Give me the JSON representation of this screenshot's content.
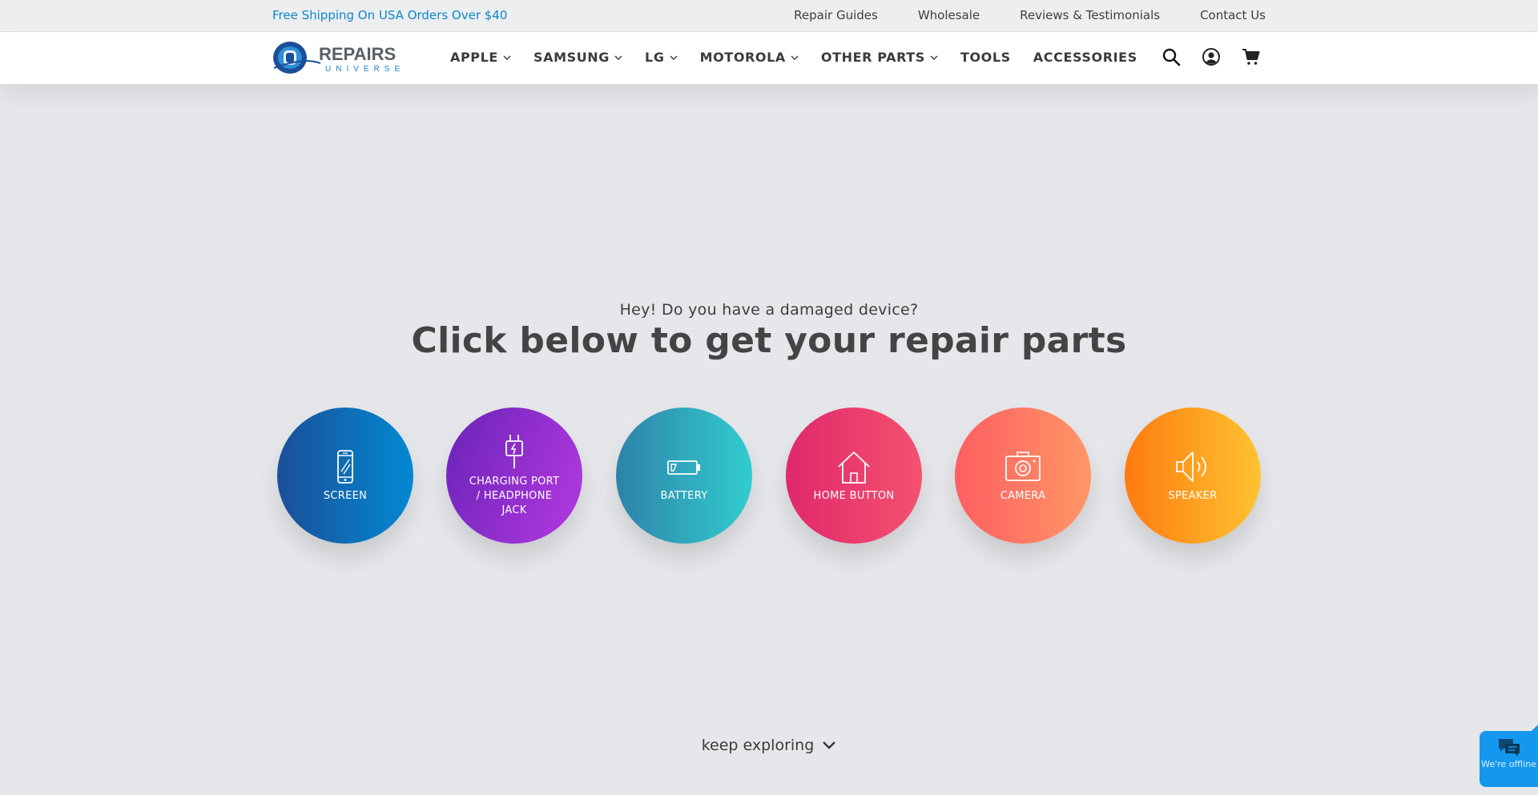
{
  "topbar": {
    "promo": "Free Shipping On USA Orders Over $40",
    "links": [
      "Repair Guides",
      "Wholesale",
      "Reviews & Testimonials",
      "Contact Us"
    ]
  },
  "brand": {
    "name_line1": "REPAIRS",
    "name_line2": "UNIVERSE",
    "colors": {
      "primary": "#1a4f98",
      "accent": "#0f86c9"
    }
  },
  "nav": {
    "items": [
      {
        "label": "APPLE",
        "dropdown": true
      },
      {
        "label": "SAMSUNG",
        "dropdown": true
      },
      {
        "label": "LG",
        "dropdown": true
      },
      {
        "label": "MOTOROLA",
        "dropdown": true
      },
      {
        "label": "OTHER PARTS",
        "dropdown": true
      },
      {
        "label": "TOOLS",
        "dropdown": false
      },
      {
        "label": "ACCESSORIES",
        "dropdown": false
      }
    ],
    "icons": [
      "search-icon",
      "account-icon",
      "cart-icon"
    ]
  },
  "hero": {
    "subtitle": "Hey! Do you have a damaged device?",
    "title": "Click below to get your repair parts"
  },
  "categories": [
    {
      "label": "SCREEN",
      "icon": "phone-screen-icon",
      "color_from": "#1a4f98",
      "color_to": "#0389d2"
    },
    {
      "label": "CHARGING PORT / HEADPHONE JACK",
      "icon": "charging-plug-icon",
      "color_from": "#6a23b8",
      "color_to": "#b43ae0"
    },
    {
      "label": "BATTERY",
      "icon": "battery-icon",
      "color_from": "#2e82a9",
      "color_to": "#31cdcf"
    },
    {
      "label": "HOME BUTTON",
      "icon": "home-icon",
      "color_from": "#e0286c",
      "color_to": "#f4526f"
    },
    {
      "label": "CAMERA",
      "icon": "camera-icon",
      "color_from": "#fe5e62",
      "color_to": "#ff9766"
    },
    {
      "label": "SPEAKER",
      "icon": "speaker-icon",
      "color_from": "#fe7b10",
      "color_to": "#ffc331"
    }
  ],
  "keep_exploring": "keep exploring",
  "chat": {
    "status": "We're offline"
  }
}
